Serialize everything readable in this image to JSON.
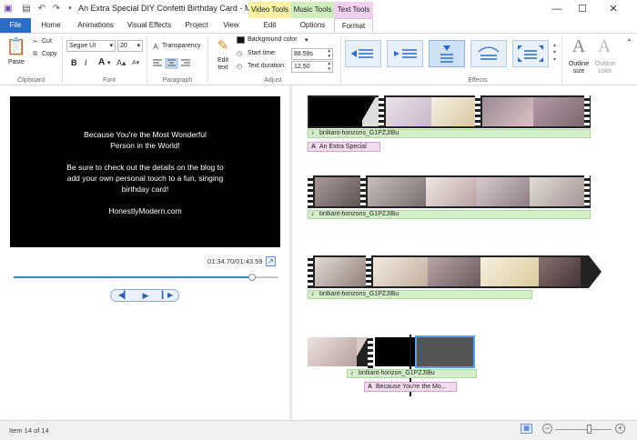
{
  "titlebar": {
    "title": "An Extra Special DIY Confetti Birthday Card - Movie ...",
    "contextual_tabs": [
      {
        "label": "Video Tools",
        "color": "#f7f1a5"
      },
      {
        "label": "Music Tools",
        "color": "#cfeec0"
      },
      {
        "label": "Text Tools",
        "color": "#f1d2ee"
      }
    ],
    "icons": [
      "save-icon",
      "undo-icon",
      "redo-icon",
      "qat-dropdown-icon",
      "minimize-icon",
      "maximize-icon",
      "close-icon"
    ]
  },
  "tabs": [
    {
      "label": "File"
    },
    {
      "label": "Home"
    },
    {
      "label": "Animations"
    },
    {
      "label": "Visual Effects"
    },
    {
      "label": "Project"
    },
    {
      "label": "View"
    },
    {
      "label": "Edit"
    },
    {
      "label": "Options"
    },
    {
      "label": "Format"
    }
  ],
  "ribbon": {
    "clipboard": {
      "paste": "Paste",
      "cut": "Cut",
      "copy": "Copy",
      "label": "Clipboard"
    },
    "font": {
      "family": "Segoe UI",
      "size": "20",
      "bold": "B",
      "italic": "I",
      "font_color": "A",
      "label": "Font"
    },
    "paragraph": {
      "transparency": "Transparency",
      "label": "Paragraph"
    },
    "adjust": {
      "edit_text": "Edit text",
      "background_color": "Background color",
      "start_time_label": "Start time:",
      "start_time_value": "88.59s",
      "text_duration_label": "Text duration:",
      "text_duration_value": "12.50",
      "label": "Adjust"
    },
    "effects": {
      "label": "Effects",
      "count": 5,
      "selected_index": 2
    },
    "outline": {
      "outline_size": "Outline size",
      "outline_color": "Outline color"
    }
  },
  "preview": {
    "lines": [
      "Because You're the Most Wonderful",
      "Person in the World!",
      "",
      "Be sure to check out the details on the blog to",
      "add your own personal touch to a fun, singing",
      "birthday card!",
      "",
      "HonestlyModern.com"
    ],
    "time": "01:34.70/01:43.59",
    "playback_progress": 0.9,
    "controls": [
      "previous-frame-icon",
      "play-icon",
      "next-frame-icon"
    ]
  },
  "storyboard": {
    "rows": [
      {
        "audio": "brilliant-horizons_G1PZJIBu",
        "text": "An Extra Special"
      },
      {
        "audio": "brilliant-horizons_G1PZJIBu"
      },
      {
        "audio": "brilliant-horizons_G1PZJIBu"
      },
      {
        "audio": "brilliant-horizon_G1PZJIBu",
        "text": "Because You're the Mo..."
      }
    ]
  },
  "statusbar": {
    "item_status": "Item 14 of 14",
    "zoom_level": 0.62
  }
}
